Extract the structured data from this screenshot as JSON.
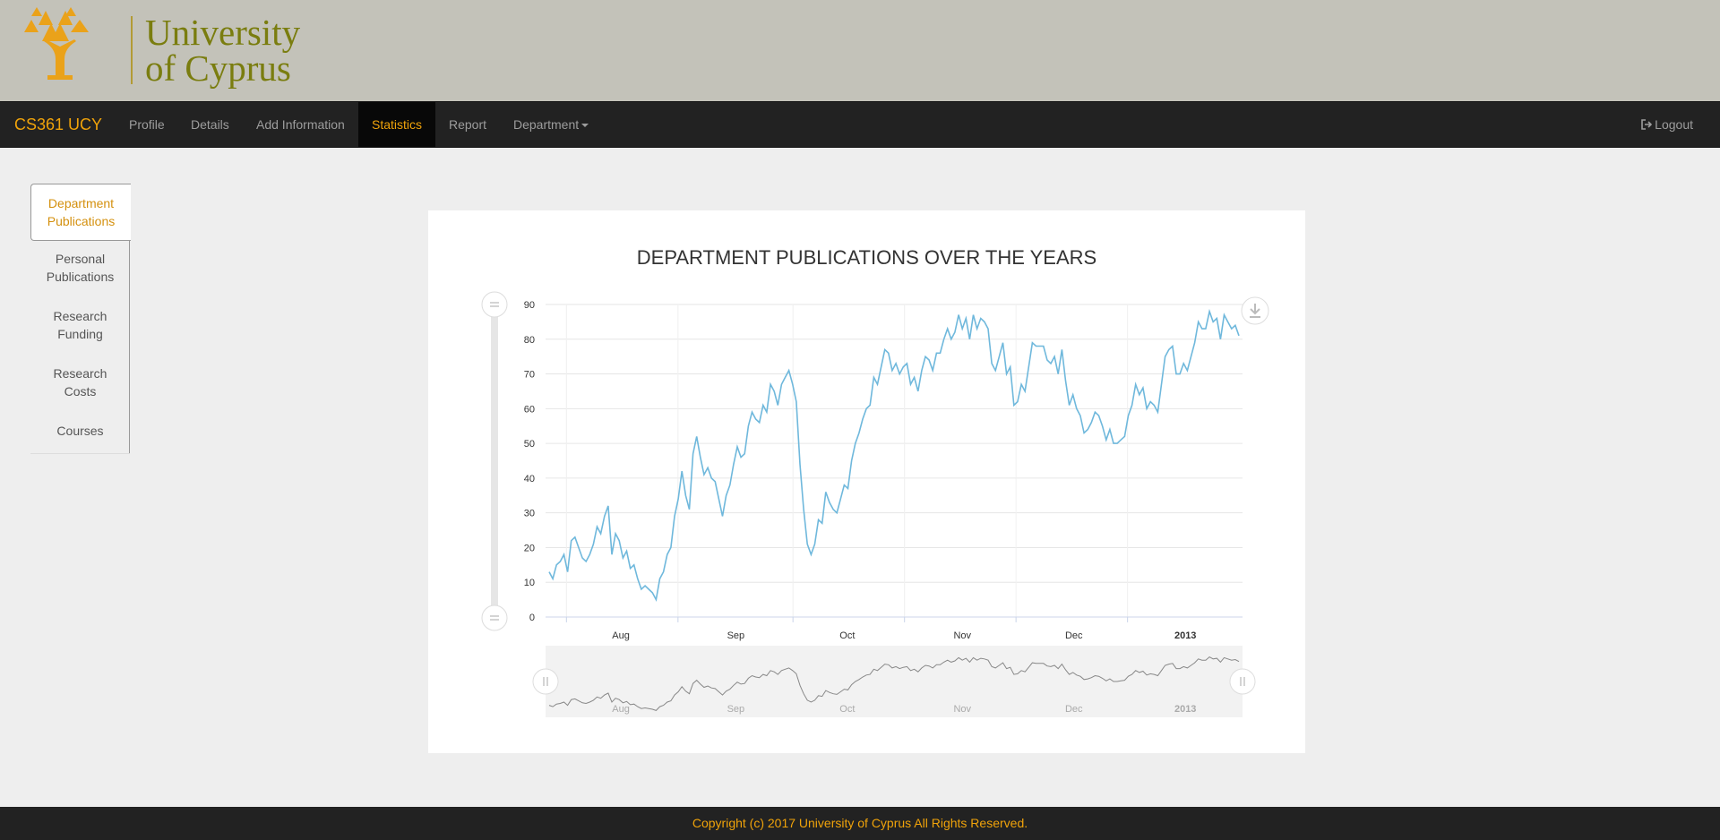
{
  "header": {
    "logo_line1": "University",
    "logo_line2": "of Cyprus"
  },
  "navbar": {
    "brand": "CS361 UCY",
    "items": [
      {
        "label": "Profile"
      },
      {
        "label": "Details"
      },
      {
        "label": "Add Information"
      },
      {
        "label": "Statistics"
      },
      {
        "label": "Report"
      },
      {
        "label": "Department"
      }
    ],
    "active": "Statistics",
    "logout_label": "Logout",
    "logout_icon": "logout-icon",
    "colors": {
      "accent": "#f0a30a",
      "bar": "#222222"
    }
  },
  "sidebar": {
    "items": [
      {
        "line1": "Department",
        "line2": "Publications"
      },
      {
        "line1": "Personal",
        "line2": "Publications"
      },
      {
        "line1": "Research",
        "line2": "Funding"
      },
      {
        "line1": "Research",
        "line2": "Costs"
      },
      {
        "line1": "Courses",
        "line2": ""
      }
    ],
    "active": "Department Publications"
  },
  "chart_data": {
    "type": "line",
    "title": "DEPARTMENT PUBLICATIONS OVER THE YEARS",
    "x_tick_labels": [
      "Aug",
      "Sep",
      "Oct",
      "Nov",
      "Dec",
      "2013"
    ],
    "y_ticks": [
      0,
      10,
      20,
      30,
      40,
      50,
      60,
      70,
      80,
      90
    ],
    "ylim": [
      0,
      90
    ],
    "grid": true,
    "line_color": "#6fb8dc",
    "values": [
      13,
      11,
      15,
      16,
      18,
      13,
      22,
      23,
      20,
      17,
      16,
      18,
      21,
      26,
      24,
      29,
      32,
      18,
      24,
      22,
      17,
      19,
      14,
      15,
      11,
      8,
      9,
      8,
      7,
      5,
      11,
      13,
      18,
      20,
      29,
      34,
      42,
      35,
      31,
      47,
      52,
      46,
      41,
      43,
      40,
      39,
      34,
      29,
      35,
      38,
      44,
      49,
      46,
      47,
      55,
      59,
      57,
      56,
      61,
      59,
      67,
      65,
      61,
      67,
      69,
      71,
      67,
      62,
      44,
      31,
      21,
      18,
      21,
      28,
      27,
      36,
      33,
      31,
      30,
      34,
      38,
      37,
      45,
      50,
      53,
      57,
      60,
      61,
      69,
      67,
      72,
      77,
      76,
      71,
      73,
      70,
      72,
      73,
      67,
      69,
      65,
      71,
      75,
      74,
      71,
      76,
      76,
      80,
      83,
      80,
      82,
      87,
      83,
      86,
      80,
      87,
      83,
      86,
      85,
      83,
      73,
      71,
      75,
      79,
      70,
      72,
      61,
      62,
      67,
      65,
      72,
      79,
      78,
      78,
      78,
      74,
      73,
      75,
      70,
      77,
      68,
      61,
      64,
      60,
      58,
      53,
      54,
      56,
      59,
      58,
      55,
      51,
      54,
      50,
      50,
      51,
      52,
      58,
      61,
      67,
      64,
      66,
      60,
      62,
      61,
      59,
      67,
      75,
      77,
      78,
      70,
      70,
      73,
      71,
      75,
      79,
      85,
      83,
      83,
      88,
      85,
      86,
      80,
      87,
      85,
      83,
      84,
      81
    ]
  },
  "navigator": {
    "labels": [
      "Aug",
      "Sep",
      "Oct",
      "Nov",
      "Dec",
      "2013"
    ]
  },
  "export_icon": "download-icon",
  "footer": {
    "text": "Copyright (c) 2017 University of Cyprus All Rights Reserved."
  }
}
